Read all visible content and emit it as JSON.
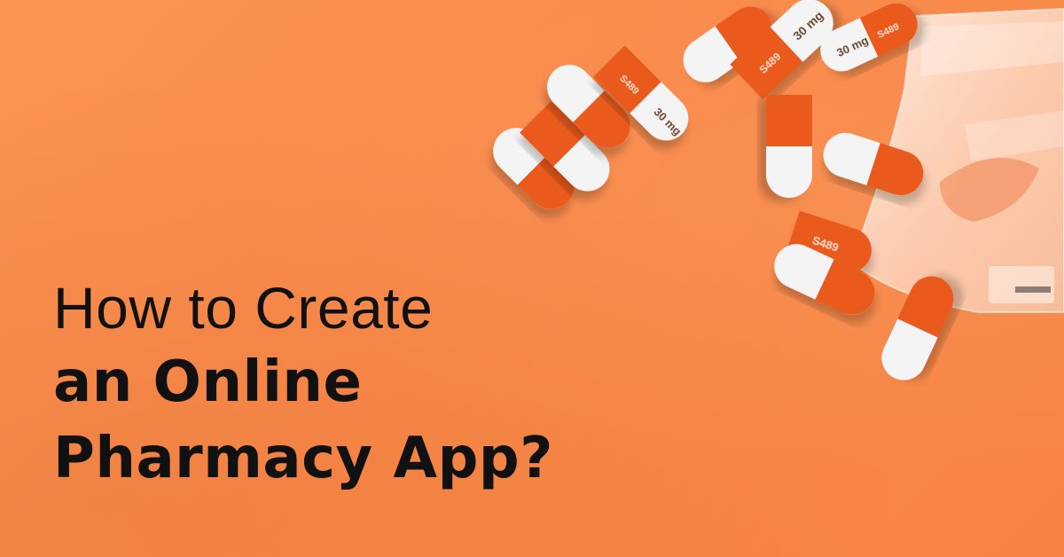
{
  "headline": {
    "line1": "How to Create",
    "line2": "an Online",
    "line3": "Pharmacy App?"
  },
  "colors": {
    "background": "#f98c4e",
    "text": "#111111",
    "capsule_orange": "#ea5a1b",
    "capsule_white": "#f4f4f4"
  },
  "capsule_imprint": [
    "30 mg",
    "S489"
  ],
  "photo": {
    "subject": "orange-and-white capsules spilling from a translucent pill bottle",
    "icon_name": "capsule-pill-icon"
  }
}
